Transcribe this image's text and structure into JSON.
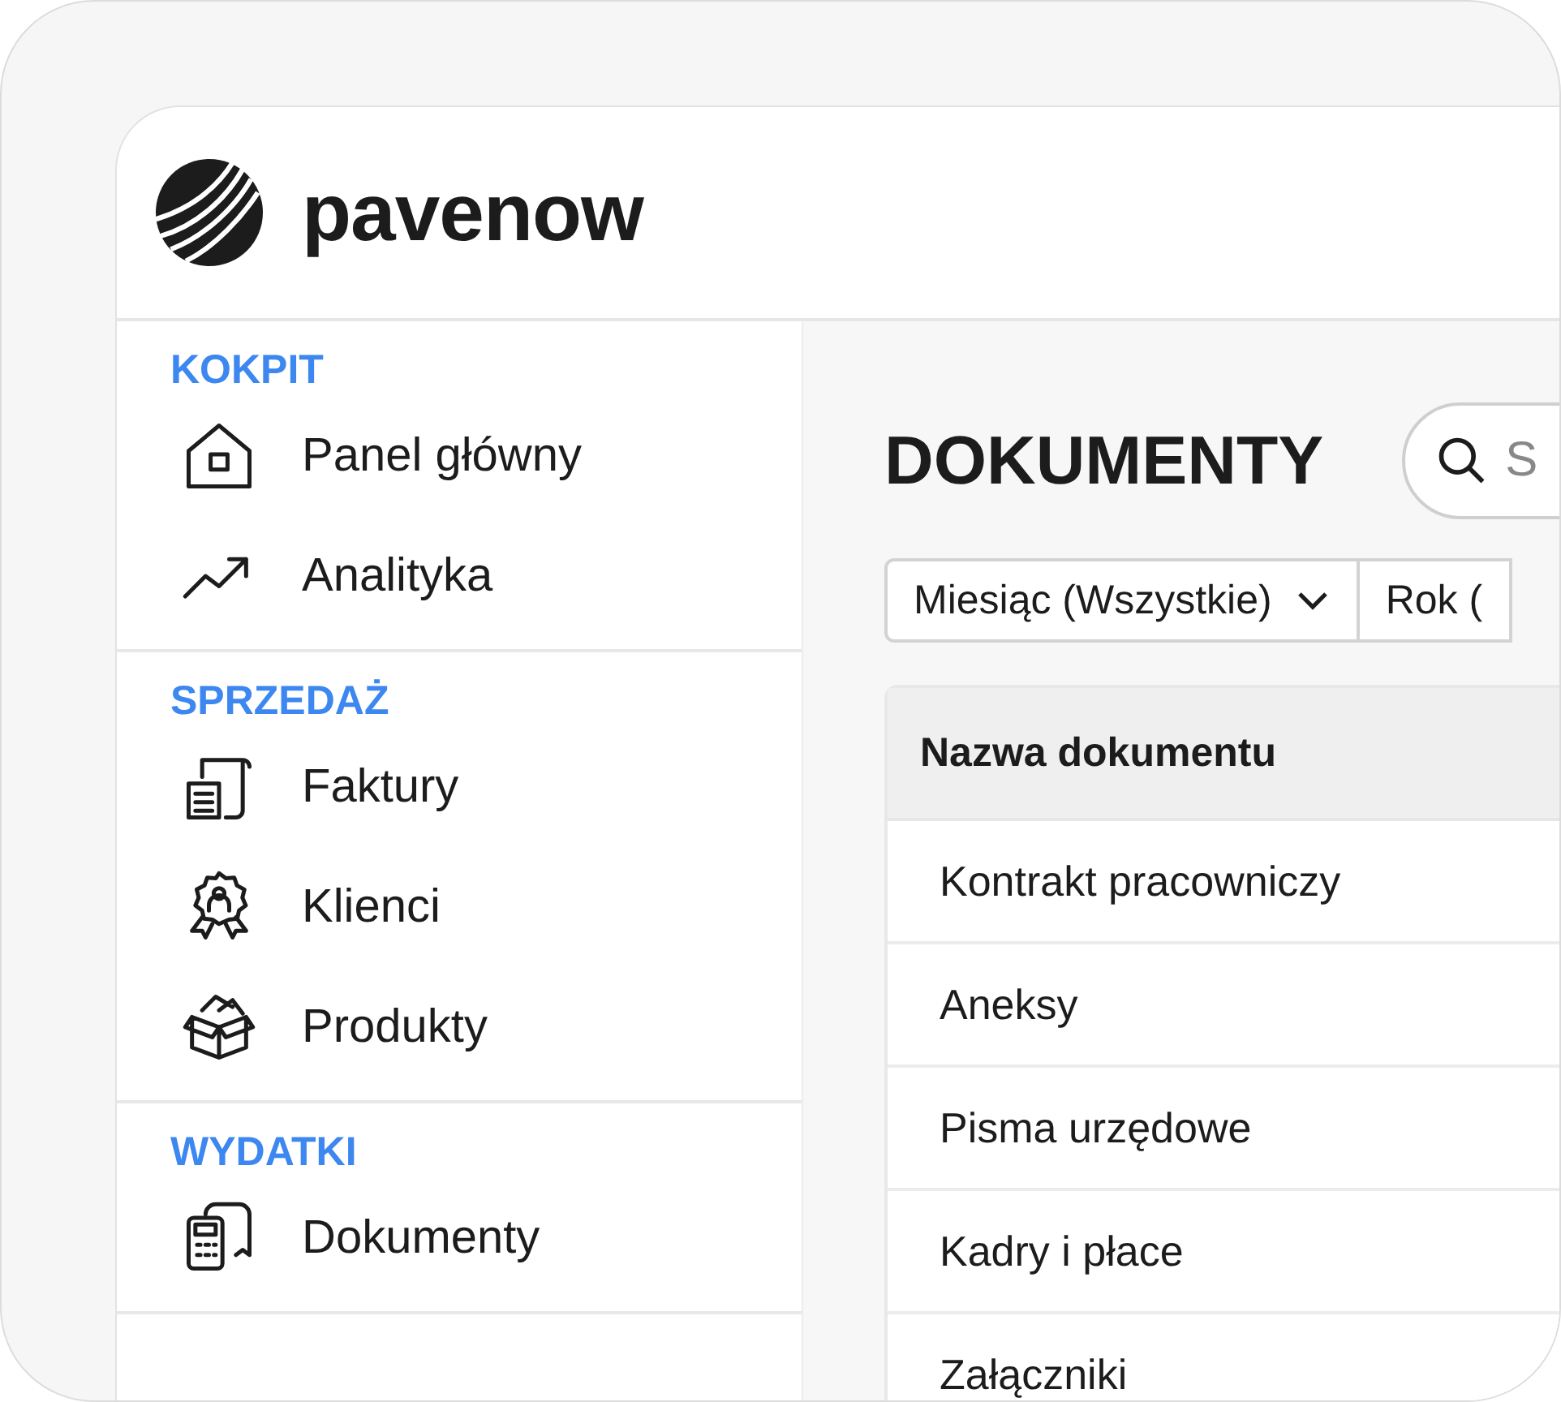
{
  "brand": {
    "name": "pavenow"
  },
  "sidebar": {
    "sections": [
      {
        "title": "KOKPIT",
        "items": [
          {
            "label": "Panel główny",
            "kind": "home"
          },
          {
            "label": "Analityka",
            "kind": "trend"
          }
        ]
      },
      {
        "title": "SPRZEDAŻ",
        "items": [
          {
            "label": "Faktury",
            "kind": "invoice"
          },
          {
            "label": "Klienci",
            "kind": "badge"
          },
          {
            "label": "Produkty",
            "kind": "box"
          }
        ]
      },
      {
        "title": "WYDATKI",
        "items": [
          {
            "label": "Dokumenty",
            "kind": "receipt"
          }
        ]
      }
    ]
  },
  "page": {
    "title": "DOKUMENTY",
    "search": {
      "placeholder": "S"
    },
    "filters": [
      {
        "label": "Miesiąc (Wszystkie)",
        "kind": "dropdown"
      },
      {
        "label": "Rok (",
        "kind": "cut"
      }
    ]
  },
  "table": {
    "columns": [
      "Nazwa dokumentu"
    ],
    "rows": [
      [
        "Kontrakt pracowniczy"
      ],
      [
        "Aneksy"
      ],
      [
        "Pisma urzędowe"
      ],
      [
        "Kadry i płace"
      ],
      [
        "Załączniki"
      ]
    ]
  }
}
